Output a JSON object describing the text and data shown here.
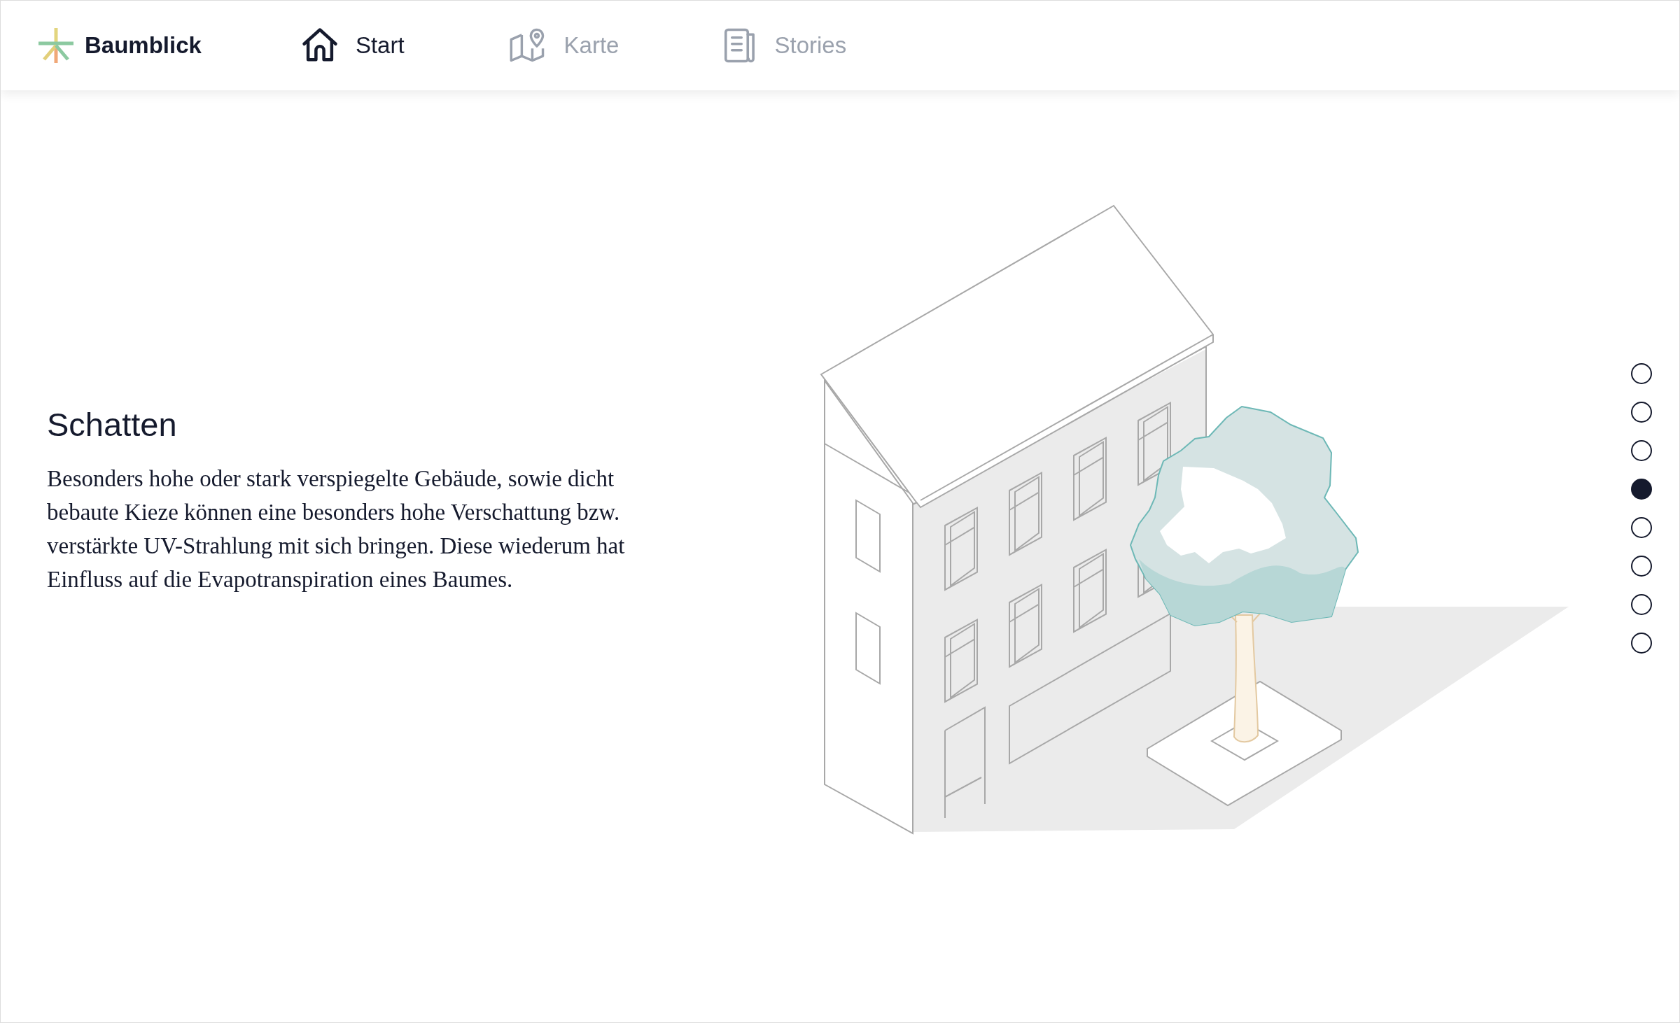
{
  "brand": {
    "name": "Baumblick"
  },
  "nav": [
    {
      "label": "Start",
      "kind": "house",
      "selected": true
    },
    {
      "label": "Karte",
      "kind": "map",
      "selected": false
    },
    {
      "label": "Stories",
      "kind": "newspaper",
      "selected": false
    }
  ],
  "section": {
    "title": "Schatten",
    "text": "Besonders hohe oder stark verspiegelte Gebäude, sowie dicht bebaute Kieze können eine besonders hohe Verschattung bzw. verstärkte UV-Strahlung mit sich bringen. Diese wiederum hat Einfluss auf die Evapotranspiration eines Baumes."
  },
  "pager": [
    {
      "selected": false
    },
    {
      "selected": false
    },
    {
      "selected": false
    },
    {
      "selected": true
    },
    {
      "selected": false
    },
    {
      "selected": false
    },
    {
      "selected": false
    },
    {
      "selected": false
    }
  ]
}
